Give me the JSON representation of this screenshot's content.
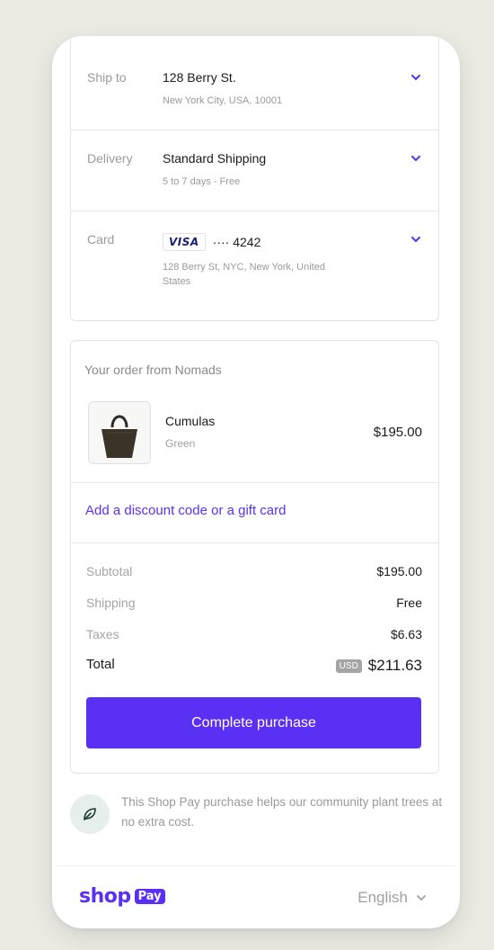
{
  "shipping": {
    "ship_to": {
      "label": "Ship to",
      "value": "128 Berry St.",
      "sub": "New York City, USA, 10001"
    },
    "delivery": {
      "label": "Delivery",
      "value": "Standard Shipping",
      "sub": "5 to 7 days - Free"
    },
    "card": {
      "label": "Card",
      "brand": "VISA",
      "number": "···· 4242",
      "sub": "128 Berry St, NYC, New York, United States"
    }
  },
  "order": {
    "heading": "Your order from Nomads",
    "item": {
      "name": "Cumulas",
      "variant": "Green",
      "price": "$195.00"
    },
    "discount_link": "Add a discount code or a gift card",
    "summary": [
      {
        "label": "Subtotal",
        "value": "$195.00"
      },
      {
        "label": "Shipping",
        "value": "Free"
      },
      {
        "label": "Taxes",
        "value": "$6.63"
      }
    ],
    "total": {
      "label": "Total",
      "currency": "USD",
      "value": "$211.63"
    },
    "button": "Complete purchase"
  },
  "eco_message": "This Shop Pay purchase helps our community plant trees at no extra cost.",
  "footer": {
    "logo_shop": "shop",
    "logo_pay": "Pay",
    "language": "English"
  },
  "colors": {
    "accent": "#5a31f4",
    "background": "#ebebe4",
    "muted_text": "#9a9a9a"
  },
  "icons": [
    "chevron-down-icon",
    "leaf-icon",
    "tote-bag-image"
  ]
}
